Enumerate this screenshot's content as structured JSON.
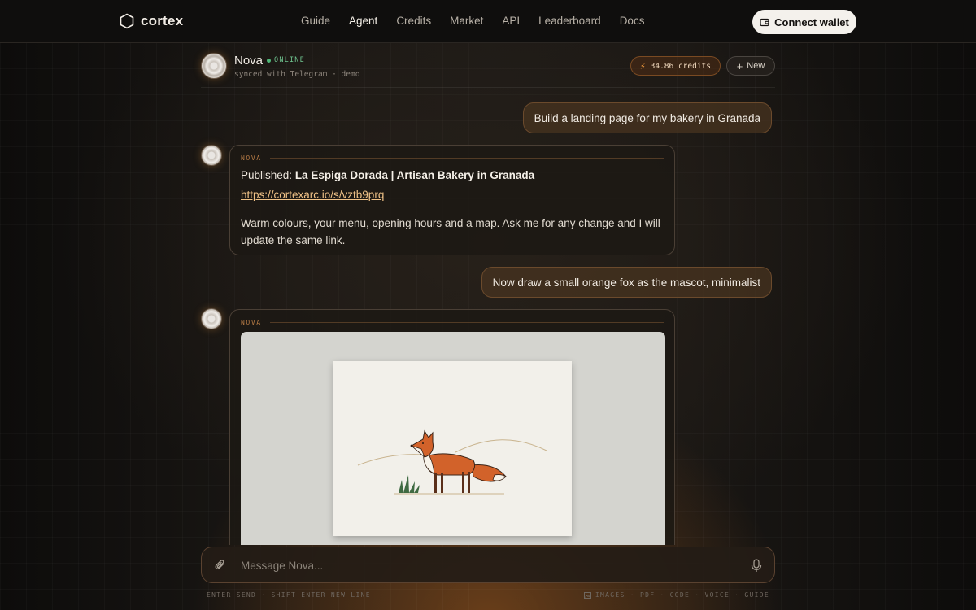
{
  "app": {
    "logo_text": "cortex",
    "nav": [
      "Guide",
      "Agent",
      "Credits",
      "Market",
      "API",
      "Leaderboard",
      "Docs"
    ],
    "active_nav": "Agent",
    "wallet_button": "Connect wallet"
  },
  "agent": {
    "name": "Nova",
    "status": "ONLINE",
    "subtitle": "synced with Telegram · demo",
    "credits": "34.86 credits",
    "new_button": "New"
  },
  "chat": {
    "user_messages": [
      "Build a landing page for my bakery in Granada",
      "Now draw a small orange fox as the mascot, minimalist"
    ],
    "assistant_label": "NOVA",
    "published_prefix": "Published:",
    "published_title": "La Espiga Dorada | Artisan Bakery in Granada",
    "published_link": "https://cortexarc.io/s/vztb9prq",
    "published_body": "Warm colours, your menu, opening hours and a map. Ask me for any change and I will update the same link.",
    "image_alt": "minimalist orange fox illustration"
  },
  "composer": {
    "placeholder": "Message Nova...",
    "hint_left": "ENTER SEND · SHIFT+ENTER NEW LINE",
    "hint_right": "IMAGES · PDF · CODE · VOICE · GUIDE"
  },
  "colors": {
    "accent": "#f39a3c",
    "online": "#4fb878",
    "link": "#f0c287"
  }
}
